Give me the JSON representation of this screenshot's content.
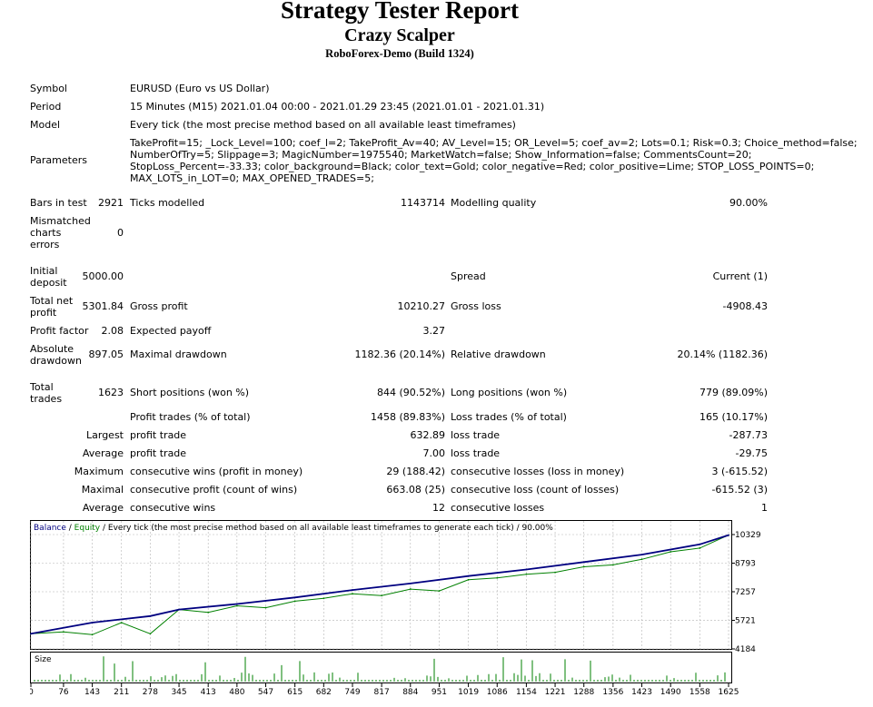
{
  "report": {
    "title": "Strategy Tester Report",
    "expert": "Crazy Scalper",
    "server": "RoboForex-Demo (Build 1324)"
  },
  "info": {
    "symbol_label": "Symbol",
    "symbol_value": "EURUSD (Euro vs US Dollar)",
    "period_label": "Period",
    "period_value": "15 Minutes (M15) 2021.01.04 00:00 - 2021.01.29 23:45 (2021.01.01 - 2021.01.31)",
    "model_label": "Model",
    "model_value": "Every tick (the most precise method based on all available least timeframes)",
    "parameters_label": "Parameters",
    "parameters_lines": [
      "TakeProfit=15; _Lock_Level=100; coef_l=2; TakeProfit_Av=40; AV_Level=15; OR_Level=5; coef_av=2; Lots=0.1; Risk=0.3; Choice_method=false;",
      "NumberOfTry=5; Slippage=3; MagicNumber=1975540; MarketWatch=false; Show_Information=false; CommentsCount=20;",
      "StopLoss_Percent=-33.33; color_background=Black; color_text=Gold; color_negative=Red; color_positive=Lime; STOP_LOSS_POINTS=0;",
      "MAX_LOTS_in_LOT=0; MAX_OPENED_TRADES=5;"
    ]
  },
  "stats": {
    "bars_label": "Bars in test",
    "bars_value": "2921",
    "ticks_label": "Ticks modelled",
    "ticks_value": "1143714",
    "quality_label": "Modelling quality",
    "quality_value": "90.00%",
    "mismatch_label": "Mismatched charts errors",
    "mismatch_value": "0",
    "deposit_label": "Initial deposit",
    "deposit_value": "5000.00",
    "spread_label": "Spread",
    "spread_value": "Current (1)",
    "netprofit_label": "Total net profit",
    "netprofit_value": "5301.84",
    "grossprofit_label": "Gross profit",
    "grossprofit_value": "10210.27",
    "grossloss_label": "Gross loss",
    "grossloss_value": "-4908.43",
    "pf_label": "Profit factor",
    "pf_value": "2.08",
    "payoff_label": "Expected payoff",
    "payoff_value": "3.27",
    "absdd_label": "Absolute drawdown",
    "absdd_value": "897.05",
    "maxdd_label": "Maximal drawdown",
    "maxdd_value": "1182.36 (20.14%)",
    "reldd_label": "Relative drawdown",
    "reldd_value": "20.14% (1182.36)",
    "trades_label": "Total trades",
    "trades_value": "1623",
    "short_label": "Short positions (won %)",
    "short_value": "844 (90.52%)",
    "long_label": "Long positions (won %)",
    "long_value": "779 (89.09%)",
    "ptrades_label": "Profit trades (% of total)",
    "ptrades_value": "1458 (89.83%)",
    "ltrades_label": "Loss trades (% of total)",
    "ltrades_value": "165 (10.17%)",
    "largest_label": "Largest",
    "largest_profit_label": "profit trade",
    "largest_profit_value": "632.89",
    "largest_loss_label": "loss trade",
    "largest_loss_value": "-287.73",
    "average_label": "Average",
    "average_profit_label": "profit trade",
    "average_profit_value": "7.00",
    "average_loss_label": "loss trade",
    "average_loss_value": "-29.75",
    "maximum_label": "Maximum",
    "max_wins_label": "consecutive wins (profit in money)",
    "max_wins_value": "29 (188.42)",
    "max_losses_label": "consecutive losses (loss in money)",
    "max_losses_value": "3 (-615.52)",
    "maximal_label": "Maximal",
    "mx_profit_label": "consecutive profit (count of wins)",
    "mx_profit_value": "663.08 (25)",
    "mx_loss_label": "consecutive loss (count of losses)",
    "mx_loss_value": "-615.52 (3)",
    "avg2_label": "Average",
    "avg_wins_label": "consecutive wins",
    "avg_wins_value": "12",
    "avg_losses_label": "consecutive losses",
    "avg_losses_value": "1"
  },
  "chart_legend": {
    "balance": "Balance",
    "sep1": " / ",
    "equity": "Equity",
    "rest": " / Every tick (the most precise method based on all available least timeframes to generate each tick) / 90.00%",
    "size_label": "Size"
  },
  "colors": {
    "balance": "#000080",
    "equity": "#008000",
    "size_bars": "#008000",
    "grid": "#b4b4b4"
  },
  "chart_data": {
    "type": "line",
    "series": [
      {
        "name": "Balance",
        "x": [
          0,
          143,
          278,
          345,
          480,
          615,
          749,
          884,
          1019,
          1154,
          1288,
          1423,
          1558,
          1625
        ],
        "y": [
          5000,
          5600,
          5950,
          6300,
          6600,
          6950,
          7350,
          7700,
          8100,
          8450,
          8850,
          9250,
          9800,
          10300
        ]
      },
      {
        "name": "Equity",
        "x": [
          0,
          76,
          143,
          211,
          278,
          345,
          413,
          480,
          547,
          615,
          682,
          749,
          817,
          884,
          951,
          1019,
          1086,
          1154,
          1221,
          1288,
          1356,
          1423,
          1490,
          1558,
          1625
        ],
        "y": [
          5000,
          5100,
          4950,
          5600,
          5000,
          6300,
          6150,
          6500,
          6400,
          6750,
          6900,
          7150,
          7050,
          7400,
          7300,
          7900,
          8000,
          8200,
          8300,
          8600,
          8700,
          9000,
          9400,
          9600,
          10300
        ]
      }
    ],
    "yticks": [
      "10329",
      "8793",
      "7257",
      "5721",
      "4184"
    ],
    "ylim": [
      4184,
      10329
    ],
    "xticks": [
      "0",
      "76",
      "143",
      "211",
      "278",
      "345",
      "413",
      "480",
      "547",
      "615",
      "682",
      "749",
      "817",
      "884",
      "951",
      "1019",
      "1086",
      "1154",
      "1221",
      "1288",
      "1356",
      "1423",
      "1490",
      "1558",
      "1625"
    ],
    "xlim": [
      0,
      1625
    ],
    "grid": true,
    "legend": "top-left"
  }
}
